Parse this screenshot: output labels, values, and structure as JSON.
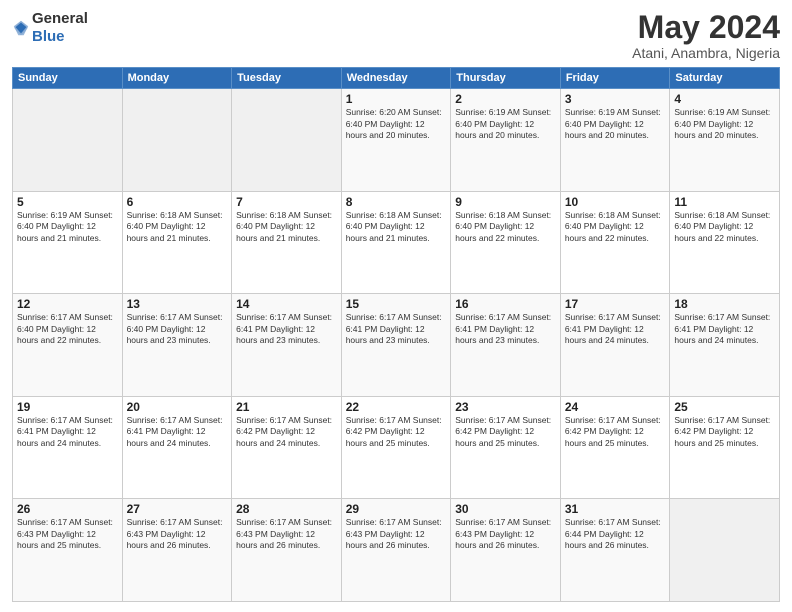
{
  "logo": {
    "text_general": "General",
    "text_blue": "Blue"
  },
  "header": {
    "title": "May 2024",
    "subtitle": "Atani, Anambra, Nigeria"
  },
  "weekdays": [
    "Sunday",
    "Monday",
    "Tuesday",
    "Wednesday",
    "Thursday",
    "Friday",
    "Saturday"
  ],
  "weeks": [
    [
      {
        "day": "",
        "info": ""
      },
      {
        "day": "",
        "info": ""
      },
      {
        "day": "",
        "info": ""
      },
      {
        "day": "1",
        "info": "Sunrise: 6:20 AM\nSunset: 6:40 PM\nDaylight: 12 hours\nand 20 minutes."
      },
      {
        "day": "2",
        "info": "Sunrise: 6:19 AM\nSunset: 6:40 PM\nDaylight: 12 hours\nand 20 minutes."
      },
      {
        "day": "3",
        "info": "Sunrise: 6:19 AM\nSunset: 6:40 PM\nDaylight: 12 hours\nand 20 minutes."
      },
      {
        "day": "4",
        "info": "Sunrise: 6:19 AM\nSunset: 6:40 PM\nDaylight: 12 hours\nand 20 minutes."
      }
    ],
    [
      {
        "day": "5",
        "info": "Sunrise: 6:19 AM\nSunset: 6:40 PM\nDaylight: 12 hours\nand 21 minutes."
      },
      {
        "day": "6",
        "info": "Sunrise: 6:18 AM\nSunset: 6:40 PM\nDaylight: 12 hours\nand 21 minutes."
      },
      {
        "day": "7",
        "info": "Sunrise: 6:18 AM\nSunset: 6:40 PM\nDaylight: 12 hours\nand 21 minutes."
      },
      {
        "day": "8",
        "info": "Sunrise: 6:18 AM\nSunset: 6:40 PM\nDaylight: 12 hours\nand 21 minutes."
      },
      {
        "day": "9",
        "info": "Sunrise: 6:18 AM\nSunset: 6:40 PM\nDaylight: 12 hours\nand 22 minutes."
      },
      {
        "day": "10",
        "info": "Sunrise: 6:18 AM\nSunset: 6:40 PM\nDaylight: 12 hours\nand 22 minutes."
      },
      {
        "day": "11",
        "info": "Sunrise: 6:18 AM\nSunset: 6:40 PM\nDaylight: 12 hours\nand 22 minutes."
      }
    ],
    [
      {
        "day": "12",
        "info": "Sunrise: 6:17 AM\nSunset: 6:40 PM\nDaylight: 12 hours\nand 22 minutes."
      },
      {
        "day": "13",
        "info": "Sunrise: 6:17 AM\nSunset: 6:40 PM\nDaylight: 12 hours\nand 23 minutes."
      },
      {
        "day": "14",
        "info": "Sunrise: 6:17 AM\nSunset: 6:41 PM\nDaylight: 12 hours\nand 23 minutes."
      },
      {
        "day": "15",
        "info": "Sunrise: 6:17 AM\nSunset: 6:41 PM\nDaylight: 12 hours\nand 23 minutes."
      },
      {
        "day": "16",
        "info": "Sunrise: 6:17 AM\nSunset: 6:41 PM\nDaylight: 12 hours\nand 23 minutes."
      },
      {
        "day": "17",
        "info": "Sunrise: 6:17 AM\nSunset: 6:41 PM\nDaylight: 12 hours\nand 24 minutes."
      },
      {
        "day": "18",
        "info": "Sunrise: 6:17 AM\nSunset: 6:41 PM\nDaylight: 12 hours\nand 24 minutes."
      }
    ],
    [
      {
        "day": "19",
        "info": "Sunrise: 6:17 AM\nSunset: 6:41 PM\nDaylight: 12 hours\nand 24 minutes."
      },
      {
        "day": "20",
        "info": "Sunrise: 6:17 AM\nSunset: 6:41 PM\nDaylight: 12 hours\nand 24 minutes."
      },
      {
        "day": "21",
        "info": "Sunrise: 6:17 AM\nSunset: 6:42 PM\nDaylight: 12 hours\nand 24 minutes."
      },
      {
        "day": "22",
        "info": "Sunrise: 6:17 AM\nSunset: 6:42 PM\nDaylight: 12 hours\nand 25 minutes."
      },
      {
        "day": "23",
        "info": "Sunrise: 6:17 AM\nSunset: 6:42 PM\nDaylight: 12 hours\nand 25 minutes."
      },
      {
        "day": "24",
        "info": "Sunrise: 6:17 AM\nSunset: 6:42 PM\nDaylight: 12 hours\nand 25 minutes."
      },
      {
        "day": "25",
        "info": "Sunrise: 6:17 AM\nSunset: 6:42 PM\nDaylight: 12 hours\nand 25 minutes."
      }
    ],
    [
      {
        "day": "26",
        "info": "Sunrise: 6:17 AM\nSunset: 6:43 PM\nDaylight: 12 hours\nand 25 minutes."
      },
      {
        "day": "27",
        "info": "Sunrise: 6:17 AM\nSunset: 6:43 PM\nDaylight: 12 hours\nand 26 minutes."
      },
      {
        "day": "28",
        "info": "Sunrise: 6:17 AM\nSunset: 6:43 PM\nDaylight: 12 hours\nand 26 minutes."
      },
      {
        "day": "29",
        "info": "Sunrise: 6:17 AM\nSunset: 6:43 PM\nDaylight: 12 hours\nand 26 minutes."
      },
      {
        "day": "30",
        "info": "Sunrise: 6:17 AM\nSunset: 6:43 PM\nDaylight: 12 hours\nand 26 minutes."
      },
      {
        "day": "31",
        "info": "Sunrise: 6:17 AM\nSunset: 6:44 PM\nDaylight: 12 hours\nand 26 minutes."
      },
      {
        "day": "",
        "info": ""
      }
    ]
  ]
}
